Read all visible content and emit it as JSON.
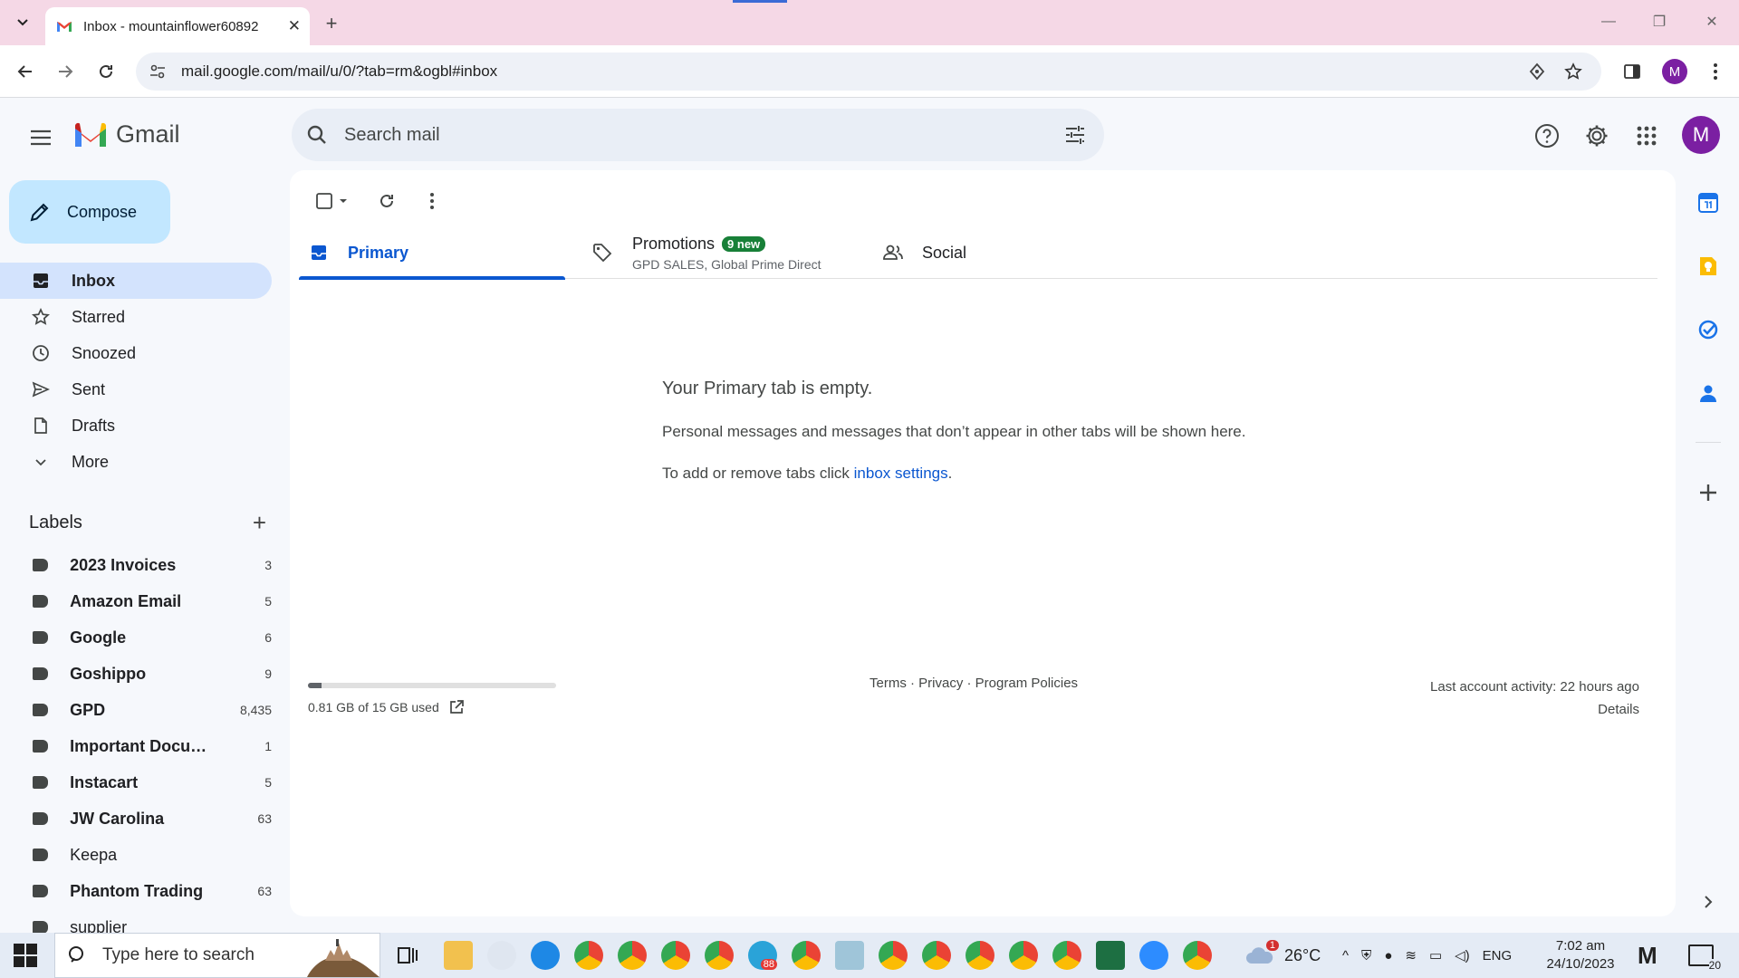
{
  "browser": {
    "tab_title": "Inbox - mountainflower60892",
    "url": "mail.google.com/mail/u/0/?tab=rm&ogbl#inbox",
    "profile_initial": "M"
  },
  "gmail": {
    "logo_text": "Gmail",
    "search_placeholder": "Search mail",
    "avatar_initial": "M",
    "compose_label": "Compose"
  },
  "nav": {
    "items": [
      {
        "label": "Inbox",
        "icon": "inbox-icon",
        "active": true
      },
      {
        "label": "Starred",
        "icon": "star-icon"
      },
      {
        "label": "Snoozed",
        "icon": "clock-icon"
      },
      {
        "label": "Sent",
        "icon": "send-icon"
      },
      {
        "label": "Drafts",
        "icon": "draft-icon"
      },
      {
        "label": "More",
        "icon": "chevron-down-icon"
      }
    ]
  },
  "labels": {
    "heading": "Labels",
    "items": [
      {
        "name": "2023 Invoices",
        "count": "3"
      },
      {
        "name": "Amazon Email",
        "count": "5"
      },
      {
        "name": "Google",
        "count": "6"
      },
      {
        "name": "Goshippo",
        "count": "9"
      },
      {
        "name": "GPD",
        "count": "8,435"
      },
      {
        "name": "Important Docume...",
        "count": "1"
      },
      {
        "name": "Instacart",
        "count": "5"
      },
      {
        "name": "JW Carolina",
        "count": "63"
      },
      {
        "name": "Keepa",
        "count": ""
      },
      {
        "name": "Phantom Trading",
        "count": "63"
      },
      {
        "name": "supplier",
        "count": ""
      }
    ]
  },
  "inbox_tabs": {
    "primary": "Primary",
    "promotions": "Promotions",
    "promotions_badge": "9 new",
    "promotions_sub": "GPD SALES, Global Prime Direct",
    "social": "Social"
  },
  "empty_state": {
    "title": "Your Primary tab is empty.",
    "line1": "Personal messages and messages that don’t appear in other tabs will be shown here.",
    "line2_prefix": "To add or remove tabs click ",
    "line2_link": "inbox settings",
    "line2_suffix": "."
  },
  "footer": {
    "storage_text": "0.81 GB of 15 GB used",
    "storage_fraction": 0.054,
    "links": "Terms · Privacy · Program Policies",
    "activity": "Last account activity: 22 hours ago",
    "details": "Details"
  },
  "taskbar": {
    "search_placeholder": "Type here to search",
    "weather": "26°C",
    "language": "ENG",
    "time": "7:02 am",
    "date": "24/10/2023",
    "notifications": "20",
    "telegram_badge": "88",
    "weather_badge": "1"
  },
  "colors": {
    "accent": "#0b57d0",
    "compose_bg": "#c2e7ff",
    "active_nav": "#d3e3fd",
    "avatar": "#7b1fa2",
    "tabstrip": "#f5d8e6"
  }
}
